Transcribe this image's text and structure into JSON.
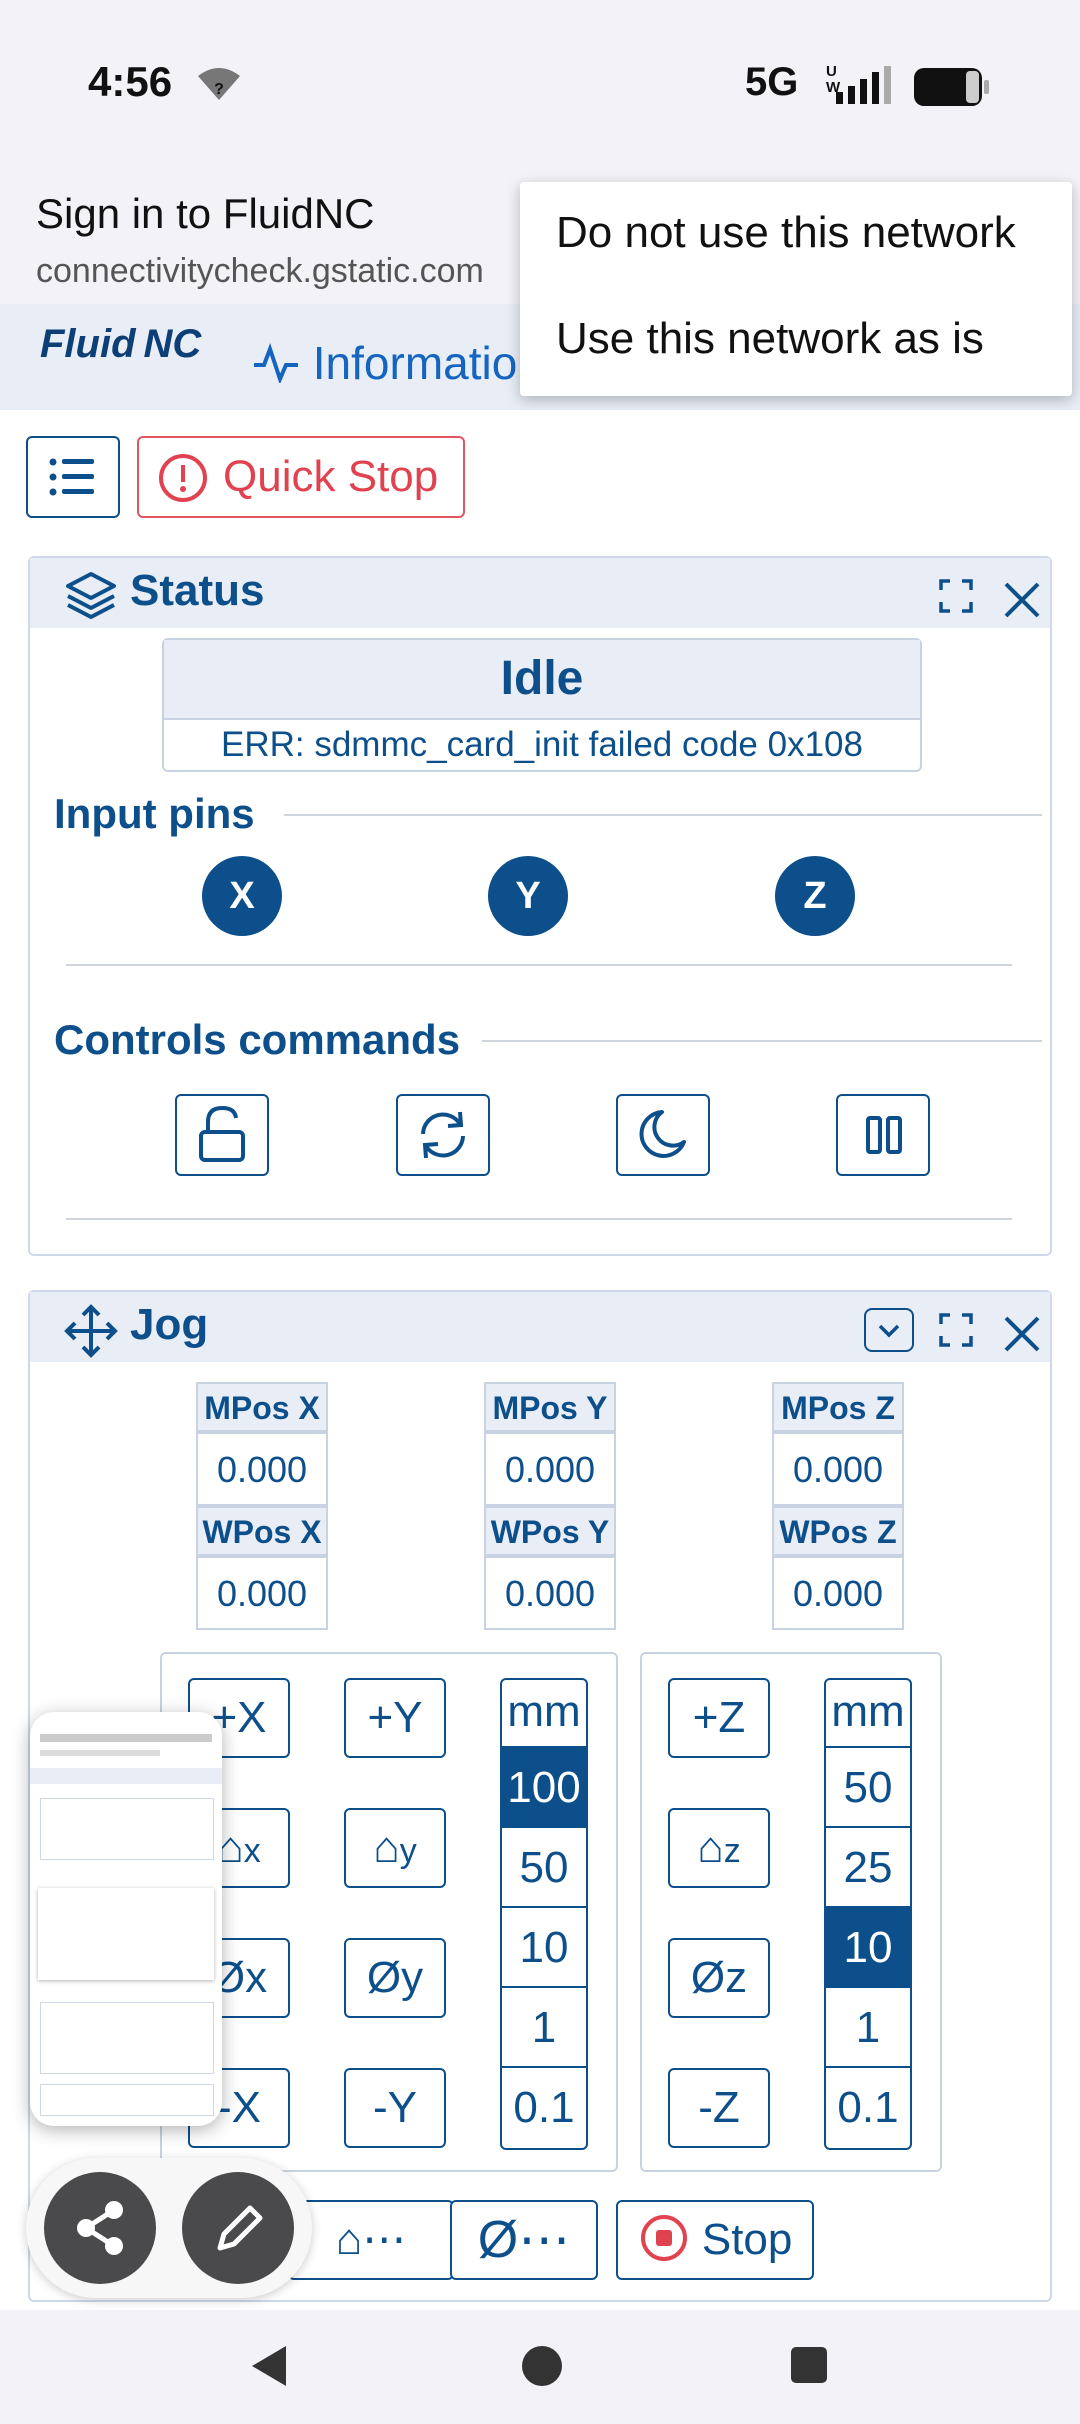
{
  "status_bar": {
    "time": "4:56",
    "network": "5G",
    "network_sub": "UW"
  },
  "header": {
    "title": "Sign in to FluidNC",
    "url": "connectivitycheck.gstatic.com"
  },
  "navbar": {
    "logo": "Fluid NC",
    "info_label": "Informatio",
    "right_partial": "i"
  },
  "popup_menu": {
    "items": [
      "Do not use this network",
      "Use this network as is"
    ]
  },
  "toolbar": {
    "quick_stop": "Quick Stop"
  },
  "status_panel": {
    "title": "Status",
    "state": "Idle",
    "message": "ERR: sdmmc_card_init failed code 0x108",
    "input_pins_title": "Input pins",
    "pins": [
      "X",
      "Y",
      "Z"
    ],
    "controls_title": "Controls commands",
    "controls": [
      "unlock-icon",
      "reset-icon",
      "sleep-icon",
      "pause-icon"
    ]
  },
  "jog_panel": {
    "title": "Jog",
    "positions": [
      {
        "mlabel": "MPos X",
        "mvalue": "0.000",
        "wlabel": "WPos X",
        "wvalue": "0.000"
      },
      {
        "mlabel": "MPos Y",
        "mvalue": "0.000",
        "wlabel": "WPos Y",
        "wvalue": "0.000"
      },
      {
        "mlabel": "MPos Z",
        "mvalue": "0.000",
        "wlabel": "WPos Z",
        "wvalue": "0.000"
      }
    ],
    "xy_buttons": {
      "plus_x": "+X",
      "plus_y": "+Y",
      "home_x": "x",
      "home_y": "y",
      "zero_x": "Øx",
      "zero_y": "Øy",
      "minus_x": "-X",
      "minus_y": "-Y"
    },
    "z_buttons": {
      "plus_z": "+Z",
      "home_z": "z",
      "zero_z": "Øz",
      "minus_z": "-Z"
    },
    "xy_steps": {
      "unit": "mm",
      "values": [
        "100",
        "50",
        "10",
        "1",
        "0.1"
      ],
      "selected": "100"
    },
    "z_steps": {
      "unit": "mm",
      "values": [
        "50",
        "25",
        "10",
        "1",
        "0.1"
      ],
      "selected": "10"
    },
    "bottom": {
      "home_all": "⋯",
      "zero_all": "Ø⋯",
      "stop": "Stop"
    }
  },
  "colors": {
    "primary": "#0d4f8b",
    "danger": "#e0434f",
    "panel_head": "#e8edf6"
  }
}
